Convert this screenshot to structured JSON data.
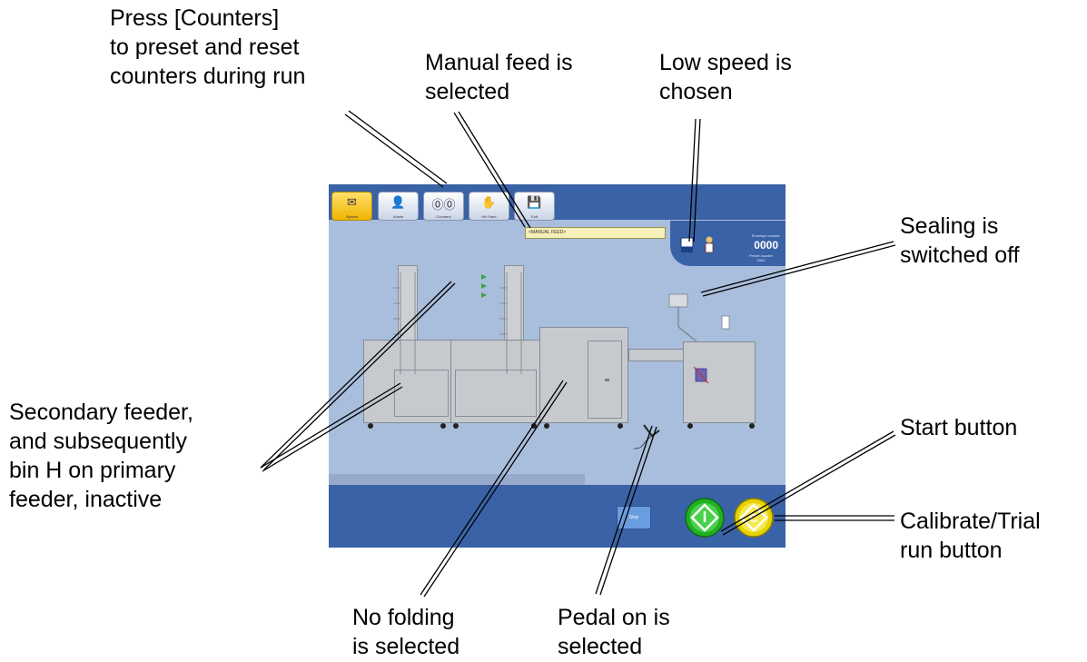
{
  "screen": {
    "tabs": [
      {
        "label": "System",
        "icon": "envelope-icon"
      },
      {
        "label": "Admin",
        "icon": "user-icon"
      },
      {
        "label": "Counters",
        "icon": "counters-icon"
      },
      {
        "label": "HH Feed",
        "icon": "hand-icon"
      },
      {
        "label": "Exit",
        "icon": "save-icon"
      }
    ],
    "status_field": "<MANUAL FEED>",
    "envelope_counter_label": "Envelope counter",
    "envelope_counter_value": "0000",
    "preset_counter_label": "Preset counter",
    "preset_counter_value": "0000",
    "stop_button_label": "Stop",
    "colors": {
      "frame": "#3a62a6",
      "canvas": "#a9bedc",
      "active_tab": "#f5c518",
      "start": "#22b022",
      "calibrate": "#e8d400"
    }
  },
  "callouts": {
    "counters": "Press [Counters]\nto preset and reset\ncounters during run",
    "manual_feed": "Manual feed is\nselected",
    "low_speed": "Low speed is\nchosen",
    "sealing": "Sealing is\nswitched off",
    "secondary_feeder": "Secondary feeder,\nand subsequently\nbin H on primary\nfeeder, inactive",
    "start": "Start button",
    "calibrate": "Calibrate/Trial\nrun button",
    "no_folding": "No folding\nis selected",
    "pedal": "Pedal on is\nselected"
  }
}
